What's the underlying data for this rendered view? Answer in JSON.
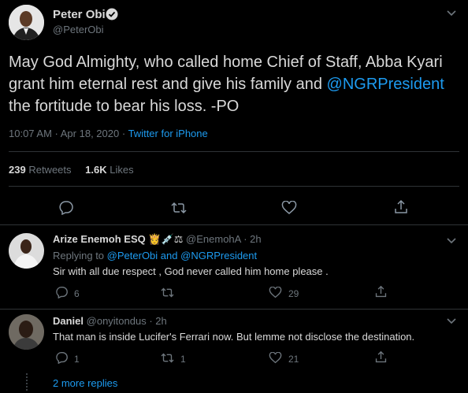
{
  "tweet": {
    "author_name": "Peter Obi",
    "author_handle": "@PeterObi",
    "text_part1": "May God Almighty, who called home Chief of Staff, Abba Kyari grant him eternal rest and give his family and",
    "mention": "@NGRPresident",
    "text_part2": "the fortitude to bear his loss. -PO",
    "time": "10:07 AM · Apr 18, 2020",
    "separator": "·",
    "source": "Twitter for iPhone",
    "retweets_count": "239",
    "retweets_label": "Retweets",
    "likes_count": "1.6K",
    "likes_label": "Likes"
  },
  "replies": [
    {
      "name": "Arize Enemoh ESQ",
      "emojis": "👸💉⚖",
      "handle": "@EnemohA",
      "time": "· 2h",
      "replying_prefix": "Replying to",
      "replying_to_1": "@PeterObi",
      "replying_and": "and",
      "replying_to_2": "@NGRPresident",
      "text": "Sir with all due respect , God never called him home please .",
      "reply_count": "6",
      "retweet_count": "",
      "like_count": "29"
    },
    {
      "name": "Daniel",
      "handle": "@onyitondus",
      "time": "· 2h",
      "text": "That man is inside Lucifer's Ferrari now. But lemme not disclose the destination.",
      "reply_count": "1",
      "retweet_count": "1",
      "like_count": "21"
    }
  ],
  "more_replies": "2 more replies",
  "colors": {
    "background": "#000000",
    "text": "#d9d9d9",
    "muted": "#6e767d",
    "accent": "#1d9bf0",
    "divider": "#2f3336"
  },
  "icons": [
    "verified-badge-icon",
    "chevron-down-icon",
    "reply-icon",
    "retweet-icon",
    "like-icon",
    "share-icon"
  ]
}
